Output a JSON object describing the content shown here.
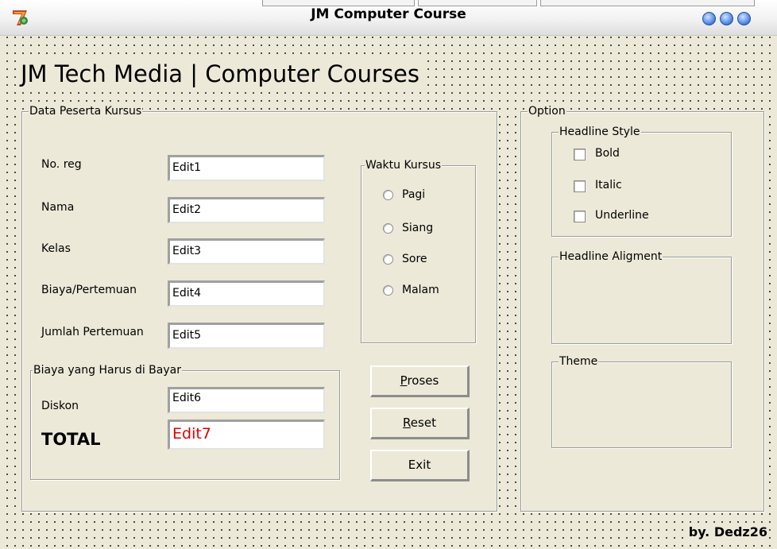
{
  "window": {
    "title": "JM Computer Course",
    "footer": "by. Dedz26"
  },
  "heading": "JM Tech Media | Computer  Courses",
  "data_peserta": {
    "label": "Data Peserta Kursus",
    "fields": [
      {
        "label": "No. reg",
        "value": "Edit1"
      },
      {
        "label": "Nama",
        "value": "Edit2"
      },
      {
        "label": "Kelas",
        "value": "Edit3"
      },
      {
        "label": "Biaya/Pertemuan",
        "value": "Edit4"
      },
      {
        "label": "Jumlah Pertemuan",
        "value": "Edit5"
      }
    ],
    "waktu_kursus": {
      "label": "Waktu Kursus",
      "options": [
        "Pagi",
        "Siang",
        "Sore",
        "Malam"
      ]
    },
    "biaya": {
      "label": "Biaya yang Harus di Bayar",
      "diskon_label": "Diskon",
      "diskon_value": "Edit6",
      "total_label": "TOTAL",
      "total_value": "Edit7",
      "total_color": "#e00000"
    },
    "buttons": {
      "proses_prefix": "",
      "proses_accel": "P",
      "proses_rest": "roses",
      "reset_prefix": "",
      "reset_accel": "R",
      "reset_rest": "eset",
      "exit_label": "Exit"
    }
  },
  "option": {
    "label": "Option",
    "headline_style": {
      "label": "Headline Style",
      "checkboxes": [
        "Bold",
        "Italic",
        "Underline"
      ]
    },
    "headline_alignment_label": "Headline Aligment",
    "theme_label": "Theme"
  },
  "colors": {
    "form_bg": "#ece9d8",
    "titlebar_button": "#5d95ec"
  }
}
